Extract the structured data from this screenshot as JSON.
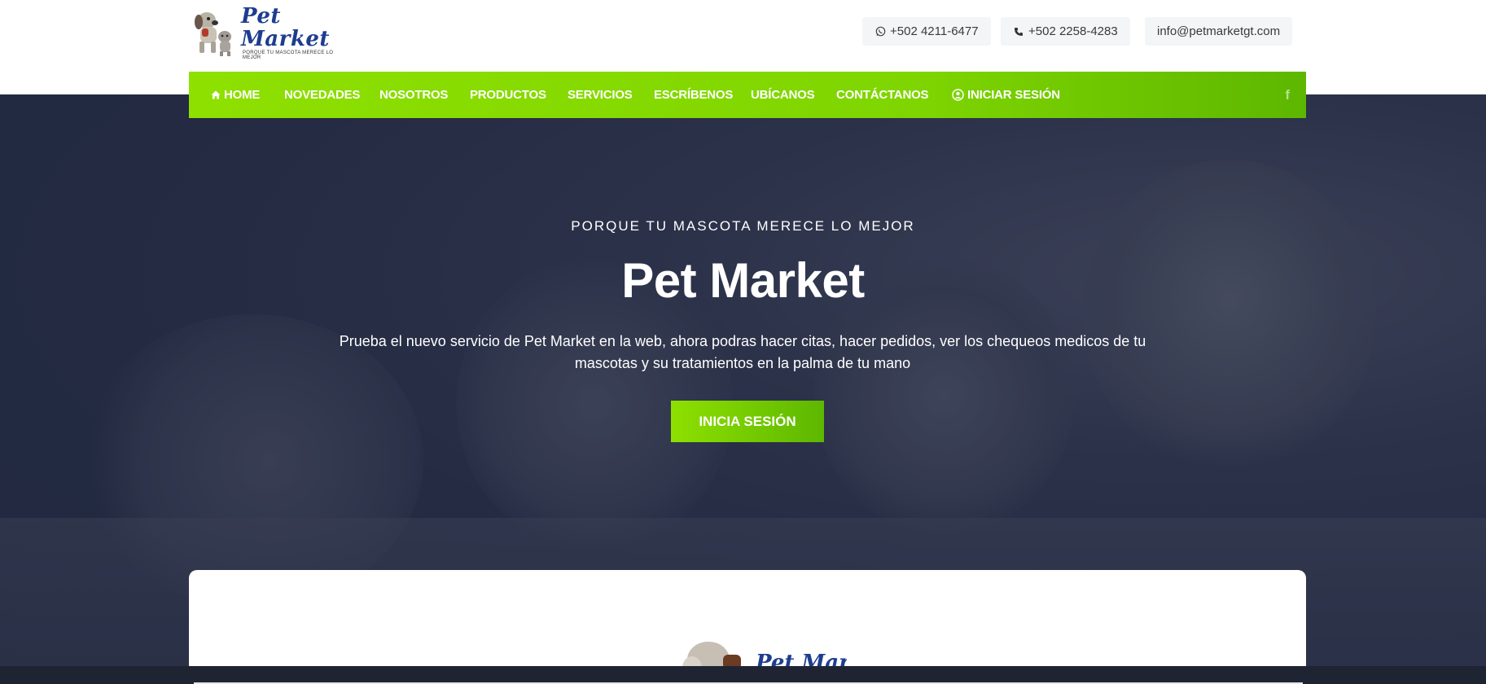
{
  "brand": {
    "title": "Pet Market",
    "tagline": "PORQUE TU MASCOTA MERECE LO MEJOR",
    "accent_color": "#7fd500"
  },
  "contacts": {
    "whatsapp": "+502 4211-6477",
    "phone": "+502 2258-4283",
    "email": "info@petmarketgt.com"
  },
  "nav": {
    "items": [
      {
        "label": "HOME",
        "icon": "home-icon"
      },
      {
        "label": "NOVEDADES"
      },
      {
        "label": "NOSOTROS"
      },
      {
        "label": "PRODUCTOS"
      },
      {
        "label": "SERVICIOS"
      },
      {
        "label": "ESCRÍBENOS"
      },
      {
        "label": "UBÍCANOS"
      },
      {
        "label": "CONTÁCTANOS"
      },
      {
        "label": "INICIAR SESIÓN",
        "icon": "user-circle-icon"
      }
    ],
    "social_icon": "facebook-icon"
  },
  "hero": {
    "subtitle": "PORQUE TU MASCOTA MERECE LO MEJOR",
    "title": "Pet Market",
    "description": "Prueba el nuevo servicio de Pet Market en la web, ahora podras hacer citas, hacer pedidos, ver los chequeos medicos de tu mascotas y su tratamientos en la palma de tu mano",
    "button_label": "INICIA SESIÓN"
  }
}
